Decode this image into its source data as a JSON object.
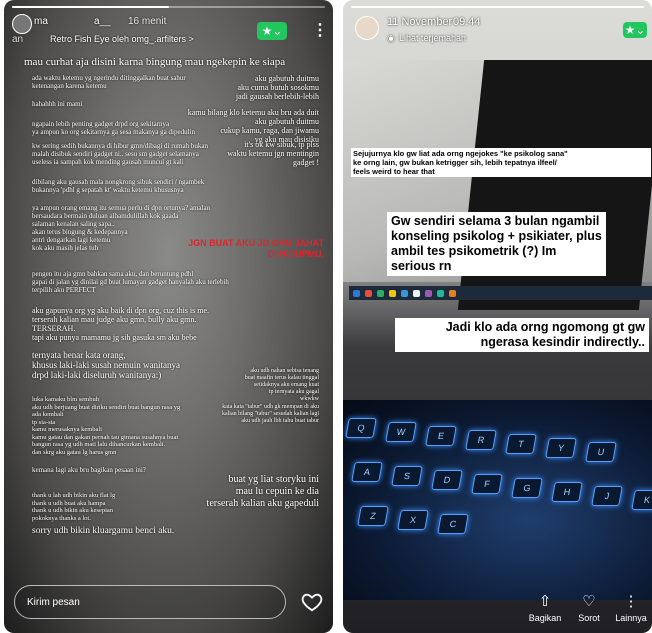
{
  "left_story": {
    "progress": 0.5,
    "username": "a__",
    "time": "16 menit",
    "user_prefix": "ma",
    "filter_label": "Retro Fish Eye oleh omg_.arfilters >",
    "sub_prefix": "an",
    "lines": [
      "mau curhat aja disini karna bingung mau ngekepin ke siapa",
      "aku gabutuh duitmu\naku cuma butuh sosokmu\njadi gausah berlebih-lebih",
      "ada waktu ketemu yg ngerindu ditinggalkan buat sahur\nketenangan karena ketemu",
      "kamu bilang klo ketemu aku bru ada duit\naku gabutuh duitmu\ncukup kamu, raga, dan jiwamu\nyg aku mau disisiku",
      "hahahhh ini mami",
      "ngapain lebih penting gadget drpd org sekitarnya\nya ampun ko org sekitarnya ga sesa makanya ga dipedulin",
      "it's ok kw sibuk, tp plss\nwaktu ketemu jgn mentingin gadget !",
      "kw sering sedih bukannya di hibur gmn/dibagi di rumah bukan\nmalah disibuk sendiri gadget ni.. sesu sm gadget selamanya\nuseless ia sampah kok mending gausah muncul gt kali",
      "dibilang aku gausah mala nongkrong sibuk sendiri / ngambek\nbukannya 'pdhl g sepatah kt' waktu ketemu khususnya",
      "ya ampun orang emang itu semua perlu di dpn ortunya? amalan\nbersaudara bermain duluan alhamdulillah kok gaada\nsalaman kenalan saling sapa..\nakan terus bingung & kedepannya\nantri dengarkan lagi ketemu\nkok aku masih jelas tuh",
      "pengen itu aja gmn bahkan sama aku, dan beruntung pdhl\ngapai di jalan yg dinilai gd buat lumayan gadget hanyalah aku terlebih\nterpilih aku PERFECT",
      "aku gapunya org yg aku baik di dpn org, cuz this is me.\nterserah kalian mau judge aku gmn, bully aku gmn.\nTERSERAH.\ntapi aku punya mamamu jg sih gasuka sm aku bebe",
      "ternyata benar kata orang,\nkhusus laki-laki susah nemuin wanitanya\ndrpd laki-laki diseluruh wanitanya:)",
      "aku udh nahan sebisa tenang\nbuat maafin terus kalau tinggal\nsetidaknya aku emang kuat\ntp ternyata aku gagal\nwkwkw",
      "luka kamaku blm sembuh\naku udh berjuang buat diriku sendiri buat bangun rasa yg\nada kembali\ntp sia-sia\nkamu merusaknya kembali\nkamu gatau dan gakan pernah tau gimana susahnya buat\nbangun rasa yg udh mati lalu dihancurkan kembali.\ndan skrg aku gatau lg harus gmn",
      "kata kata \"tabur\" udh gk mempan di aku\nkalian bilang \"tabur\" sesudah kalian lagi\naku udh jauh lbh tahu buat tabur",
      "kemana lagi aku bru bagikan pesaan ini?",
      "buat yg liat storyku ini\nmau lu cepuin ke dia\nterserah kalian aku gapeduli",
      "thank u lah udh bikin aku flat lg\nthank u udh buat aku hampa\nthank u udh bikin aku kesepian\npokoknya thanks a lot.",
      "sorry udh bikin kluargamu benci aku."
    ],
    "red_text": "JGN BUAT AKU JD ORG JAHAT\nDI HIDUPMU.",
    "reply_placeholder": "Kirim pesan"
  },
  "right_story": {
    "progress": 1.0,
    "date": "11 November",
    "time": "09.44",
    "seen_label": "Lihat terjemahan",
    "tag1": "Sejujurnya klo gw liat ada orng ngejokes \"ke psikolog sana\"\nke orng lain, gw bukan ketrigger sih, lebih tepatnya ilfeel/\nfeels weird to hear that",
    "tag2": "Gw sendiri selama 3 bulan ngambil\nkonseling psikolog + psikiater, plus\nambil tes psikometrik (?) Im\nserious rn",
    "tag3": "Jadi klo ada orng ngomong gt gw\nngerasa kesindir indirectly..",
    "keys": [
      "Q",
      "W",
      "E",
      "R",
      "T",
      "Y",
      "U",
      "A",
      "S",
      "D",
      "F",
      "G",
      "H",
      "J",
      "K",
      "L",
      "Z",
      "X",
      "C"
    ],
    "actions": [
      {
        "icon": "share-icon",
        "glyph": "⇧",
        "label": "Bagikan"
      },
      {
        "icon": "highlight-icon",
        "glyph": "♡",
        "label": "Sorot"
      },
      {
        "icon": "more-icon",
        "glyph": "⋮",
        "label": "Lainnya"
      }
    ]
  },
  "colors": {
    "accent_green": "#22c55e",
    "red_text": "#e0242b"
  }
}
